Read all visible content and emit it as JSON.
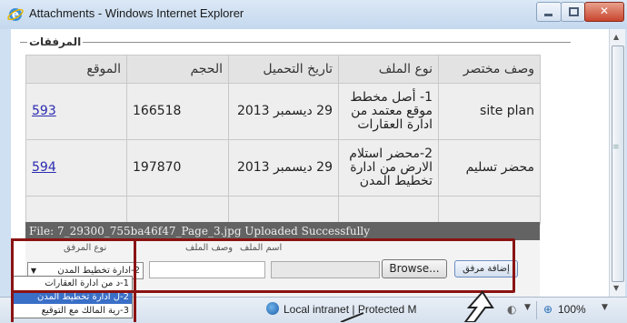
{
  "window": {
    "title": "Attachments - Windows Internet Explorer",
    "close_glyph": "✕"
  },
  "section": {
    "legend": "المرفقات"
  },
  "table": {
    "headers": [
      "وصف مختصر",
      "نوع الملف",
      "تاريخ التحميل",
      "الحجم",
      "الموقع"
    ],
    "rows": [
      {
        "description": "site plan",
        "file_type": "1- أصل مخطط موقع معتمد من ادارة العقارات",
        "date": "29 ديسمبر 2013",
        "size": "166518",
        "location": "593"
      },
      {
        "description": "محضر تسليم",
        "file_type": "2-محضر استلام الارض من ادارة تخطيط المدن",
        "date": "29 ديسمبر 2013",
        "size": "197870",
        "location": "594"
      }
    ]
  },
  "upload_status": "File: 7_29300_755ba46f47_Page_3.jpg Uploaded Successfully",
  "form": {
    "type_label": "نوع المرفق",
    "description_label": "وصف الملف",
    "filename_label": "اسم الملف",
    "type_selected": "2-ادارة تخطيط المدن",
    "browse_label": "Browse...",
    "attach_label": "إضافة مرفق"
  },
  "dropdown_options": [
    {
      "label": "1-د من ادارة العقارات",
      "selected": false
    },
    {
      "label": "2-ل ادارة تخطيط المدن",
      "selected": true
    },
    {
      "label": "3-رية المالك مع التوقيع",
      "selected": false
    }
  ],
  "statusbar": {
    "zone": "Local intranet | Protected M",
    "zoom": "100%"
  },
  "colors": {
    "highlight_frame": "#8a1313",
    "selected_option": "#3a6fc7"
  },
  "icons": [
    "ie-logo-icon",
    "minimize-icon",
    "maximize-icon",
    "close-icon",
    "globe-icon",
    "zoom-icon",
    "dropdown-arrow-icon"
  ]
}
